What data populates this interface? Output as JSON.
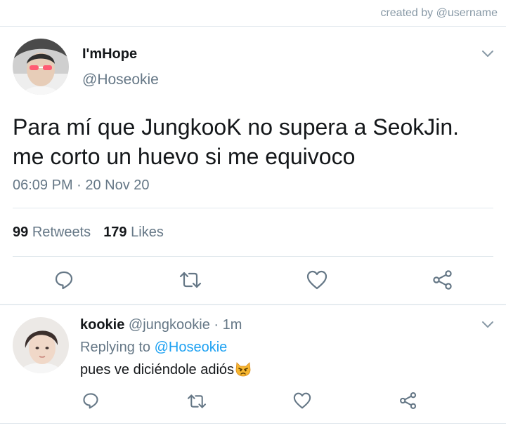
{
  "credit": "created by @username",
  "tweet": {
    "display_name": "I'mHope",
    "handle": "@Hoseokie",
    "text_line1": "Para mí que JungkooK no supera a SeokJin.",
    "text_line2": "me corto un huevo si me equivoco",
    "timestamp": "06:09 PM · 20 Nov 20",
    "retweets_count": "99",
    "retweets_label": "Retweets",
    "likes_count": "179",
    "likes_label": "Likes"
  },
  "reply": {
    "display_name": "kookie",
    "handle_time": "@jungkookie · 1m",
    "replying_prefix": "Replying to",
    "replying_handle": "@Hoseokie",
    "text": "pues ve diciéndole adiós"
  },
  "icons": {
    "reply": "reply-icon",
    "retweet": "retweet-icon",
    "like": "heart-icon",
    "share": "share-icon",
    "more": "chevron-down-icon",
    "emoji": "pouting-cat-emoji"
  },
  "colors": {
    "text": "#14171a",
    "secondary": "#657786",
    "link": "#1da1f2",
    "icon": "#657786",
    "border": "#e1e8ed"
  }
}
